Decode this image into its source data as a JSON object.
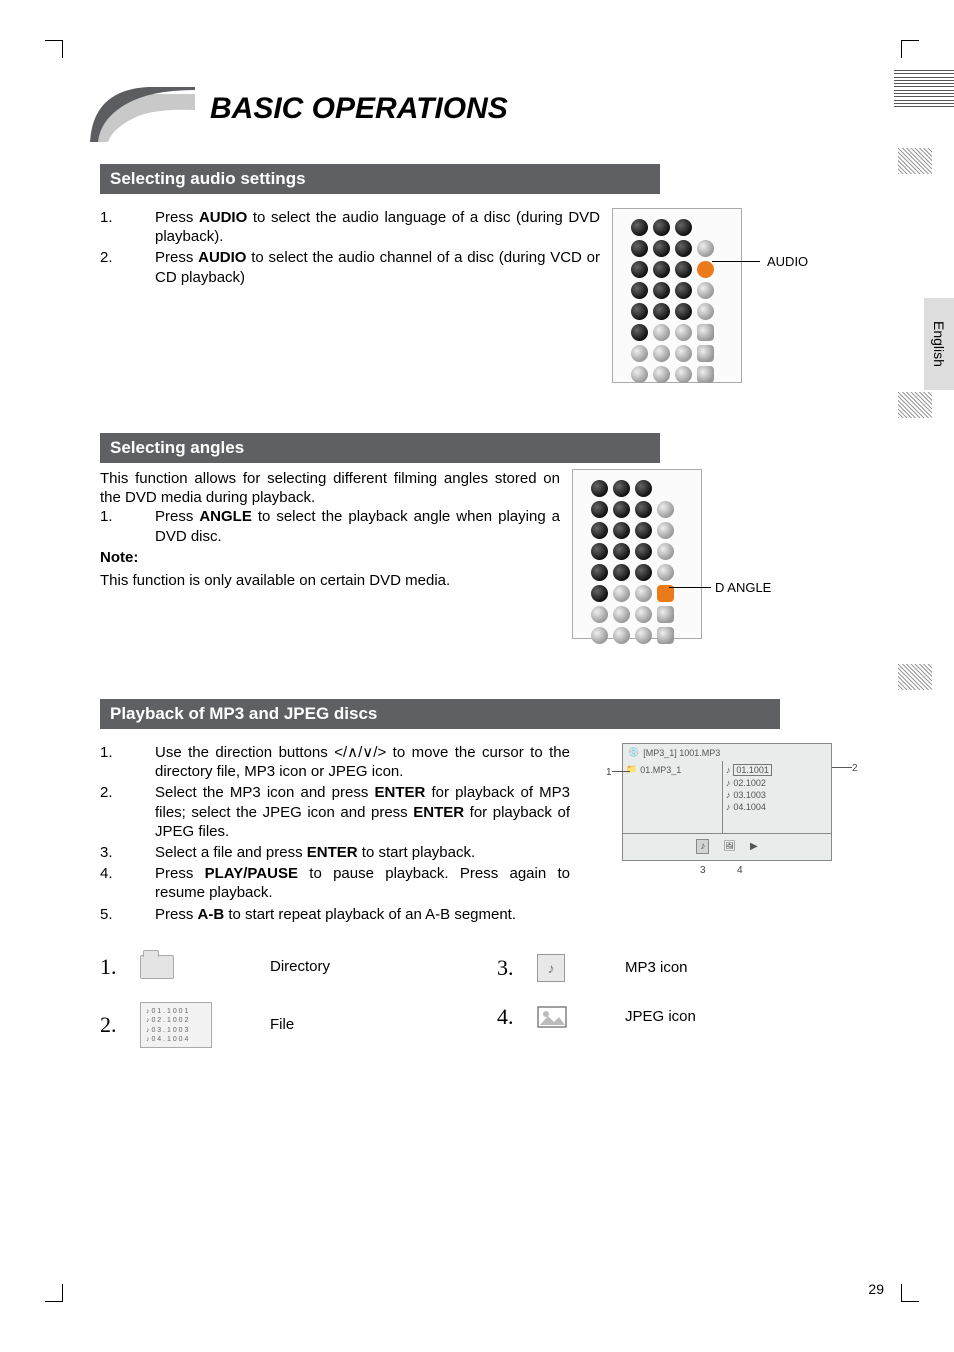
{
  "title": "BASIC OPERATIONS",
  "side_tab": "English",
  "page_number": "29",
  "sections": {
    "s1": {
      "heading": "Selecting audio settings",
      "items": [
        {
          "n": "1.",
          "pre": "Press ",
          "b": "AUDIO",
          "post": " to select the audio language of a disc (during DVD playback)."
        },
        {
          "n": "2.",
          "pre": "Press ",
          "b": "AUDIO",
          "post": " to select the audio channel of a disc (during VCD or CD playback)"
        }
      ],
      "callout": "AUDIO"
    },
    "s2": {
      "heading": "Selecting angles",
      "intro": "This function allows for selecting different filming angles stored on the DVD media during playback.",
      "items": [
        {
          "n": "1.",
          "pre": "Press ",
          "b": "ANGLE",
          "post": " to select the playback angle when playing a DVD disc."
        }
      ],
      "note_label": "Note:",
      "note_text": "This function is only available on certain DVD media.",
      "callout": "D ANGLE"
    },
    "s3": {
      "heading": "Playback of MP3 and JPEG discs",
      "items": [
        {
          "n": "1.",
          "text": "Use the direction buttons </∧/∨/> to move the cursor to the directory file, MP3 icon or JPEG icon."
        },
        {
          "n": "2.",
          "text_parts": [
            "Select the MP3 icon and press ",
            "ENTER",
            " for playback of MP3 files; select the JPEG icon and press ",
            "ENTER",
            " for playback of JPEG files."
          ]
        },
        {
          "n": "3.",
          "text_parts": [
            "Select a file and press ",
            "ENTER",
            " to start playback."
          ]
        },
        {
          "n": "4.",
          "text_parts": [
            "Press ",
            "PLAY/PAUSE",
            " to pause playback. Press again to resume playback."
          ]
        },
        {
          "n": "5.",
          "text_parts": [
            "Press ",
            "A-B",
            " to start repeat playback of an A-B segment."
          ]
        }
      ],
      "screen": {
        "header": "[MP3_1] 1001.MP3",
        "left": "01.MP3_1",
        "right": [
          "01.1001",
          "02.1002",
          "03.1003",
          "04.1004"
        ],
        "pointer1": "1",
        "pointer2": "2",
        "pointer3": "3",
        "pointer4": "4"
      }
    }
  },
  "legend": {
    "l1": {
      "n": "1.",
      "label": "Directory"
    },
    "l2": {
      "n": "2.",
      "label": "File",
      "lines": [
        "♪ 0 1 . 1 0 0 1",
        "♪ 0 2 . 1 0 0 2",
        "♪ 0 3 . 1 0 0 3",
        "♪ 0 4 . 1 0 0 4"
      ]
    },
    "l3": {
      "n": "3.",
      "label": "MP3 icon"
    },
    "l4": {
      "n": "4.",
      "label": "JPEG icon"
    }
  }
}
